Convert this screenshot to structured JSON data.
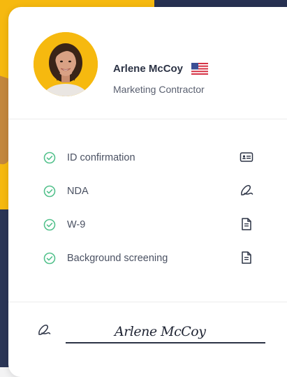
{
  "profile": {
    "name": "Arlene McCoy",
    "role": "Marketing Contractor",
    "flag_icon": "us-flag-icon"
  },
  "checklist": [
    {
      "label": "ID confirmation",
      "status_icon": "check-circle-icon",
      "action_icon": "id-card-icon"
    },
    {
      "label": "NDA",
      "status_icon": "check-circle-icon",
      "action_icon": "signature-pen-icon"
    },
    {
      "label": "W-9",
      "status_icon": "check-circle-icon",
      "action_icon": "document-icon"
    },
    {
      "label": "Background screening",
      "status_icon": "check-circle-icon",
      "action_icon": "document-icon"
    }
  ],
  "signature": {
    "text": "Arlene McCoy",
    "icon": "signature-pen-icon"
  },
  "colors": {
    "accent_yellow": "#f6b90f",
    "check_green": "#53c18c",
    "text_dark": "#2c3345",
    "navy": "#2a3556"
  }
}
